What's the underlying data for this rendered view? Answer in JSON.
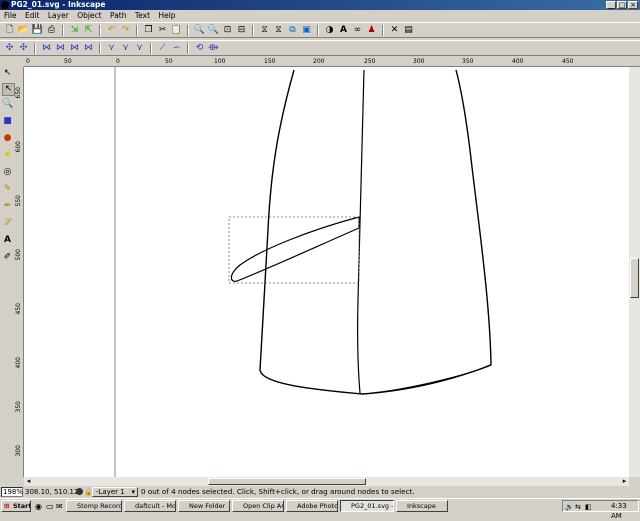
{
  "window": {
    "title": "PG2_01.svg - Inkscape",
    "min_label": "_",
    "max_label": "□",
    "close_label": "×"
  },
  "menu": {
    "items": [
      "File",
      "Edit",
      "Layer",
      "Object",
      "Path",
      "Text",
      "Help"
    ]
  },
  "toolbar_main": {
    "icons": [
      "new-icon",
      "open-icon",
      "save-icon",
      "print-icon",
      "import-icon",
      "export-icon",
      "undo-icon",
      "redo-icon",
      "copy-icon",
      "cut-icon",
      "paste-icon",
      "zoom-selection-icon",
      "zoom-drawing-icon",
      "zoom-page-icon",
      "zoom-width-icon",
      "duplicate-icon",
      "clone-icon",
      "unlink-clone-icon",
      "group-icon",
      "ungroup-icon",
      "fill-stroke-icon",
      "text-font-icon",
      "xml-editor-icon",
      "align-icon",
      "preferences-icon",
      "document-props-icon"
    ]
  },
  "toolbar_node": {
    "icons": [
      "insert-node-icon",
      "delete-node-icon",
      "join-nodes-icon",
      "join-segment-icon",
      "delete-segment-icon",
      "break-node-icon",
      "cusp-node-icon",
      "smooth-node-icon",
      "symmetric-node-icon",
      "line-segment-icon",
      "curve-segment-icon",
      "object-to-path-icon",
      "stroke-to-path-icon"
    ]
  },
  "tools": {
    "items": [
      "selector-icon",
      "node-editor-icon",
      "zoom-icon",
      "rectangle-icon",
      "ellipse-icon",
      "star-icon",
      "spiral-icon",
      "pencil-icon",
      "pen-icon",
      "calligraphy-icon",
      "text-icon",
      "dropper-icon"
    ]
  },
  "hruler": {
    "labels": [
      "0",
      "50",
      "0",
      "50",
      "100",
      "150",
      "200",
      "250",
      "300",
      "350",
      "400",
      "450"
    ]
  },
  "vruler": {
    "labels": [
      "650",
      "600",
      "550",
      "500",
      "450",
      "400",
      "350",
      "300"
    ]
  },
  "status": {
    "zoom": "198%",
    "coords": "308.10, 510.12",
    "layer": "-Layer 1",
    "message": "0 out of 4 nodes selected. Click, Shift+click, or drag around nodes to select."
  },
  "taskbar": {
    "start": "Start",
    "tasks": [
      "Stomp Record...",
      "daftcult - Mozil...",
      "New Folder",
      "Open Clip Art ...",
      "Adobe Photos...",
      "PG2_01.svg - ...",
      "Inkscape"
    ],
    "clock": "4:33 AM"
  }
}
